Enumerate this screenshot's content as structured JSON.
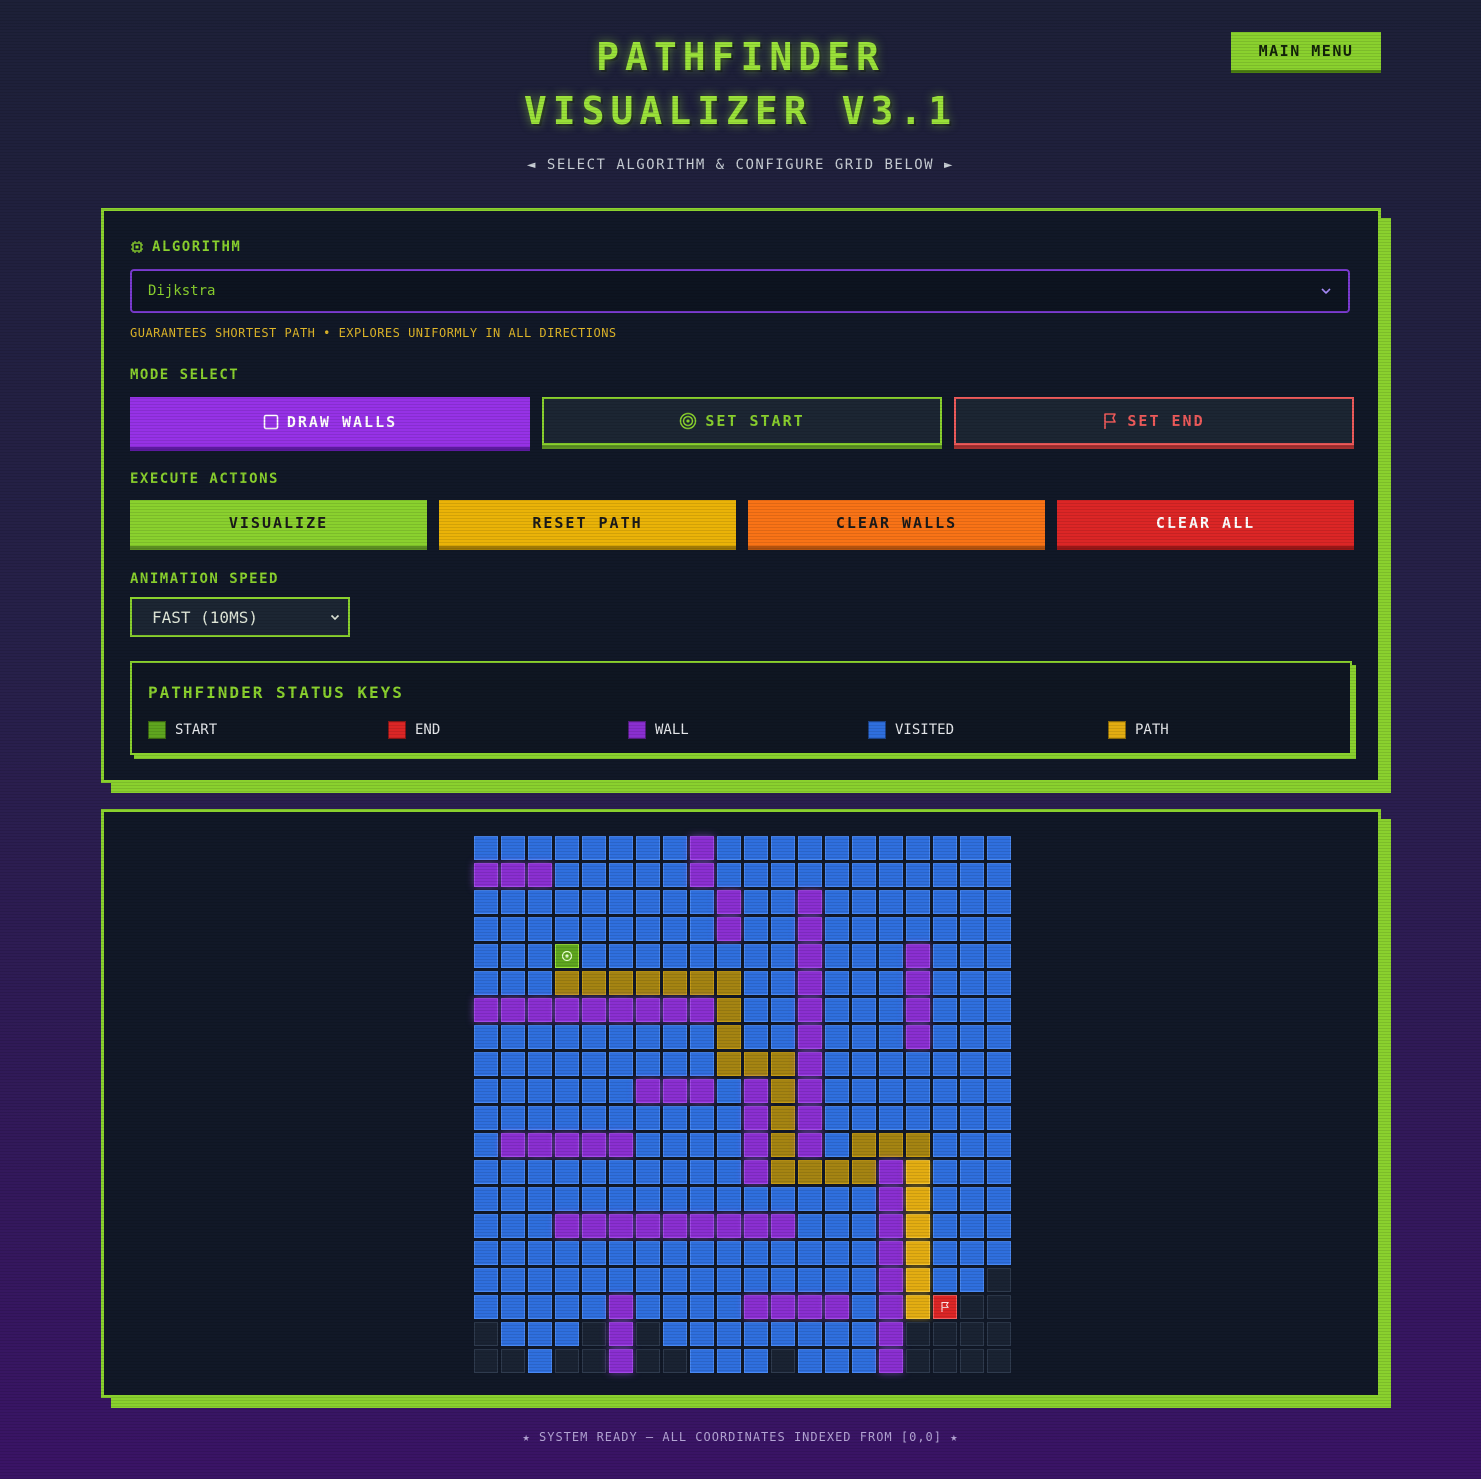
{
  "header": {
    "title_line1": "PATHFINDER",
    "title_line2": "VISUALIZER V3.1",
    "subtitle": "◄ SELECT ALGORITHM & CONFIGURE GRID BELOW ►",
    "main_menu_label": "MAIN MENU"
  },
  "algorithm": {
    "label": "ALGORITHM",
    "selected": "Dijkstra",
    "description": "GUARANTEES SHORTEST PATH • EXPLORES UNIFORMLY IN ALL DIRECTIONS"
  },
  "mode": {
    "label": "MODE SELECT",
    "draw_walls": "DRAW WALLS",
    "set_start": "SET START",
    "set_end": "SET END",
    "active": "draw_walls"
  },
  "actions": {
    "label": "EXECUTE ACTIONS",
    "visualize": "VISUALIZE",
    "reset_path": "RESET PATH",
    "clear_walls": "CLEAR WALLS",
    "clear_all": "CLEAR ALL"
  },
  "speed": {
    "label": "ANIMATION SPEED",
    "selected": "FAST (10MS)"
  },
  "legend": {
    "title": "PATHFINDER STATUS KEYS",
    "items": [
      {
        "label": "START",
        "color": "#5fa61f"
      },
      {
        "label": "END",
        "color": "#dc2626"
      },
      {
        "label": "WALL",
        "color": "#8a2fd1"
      },
      {
        "label": "VISITED",
        "color": "#2f6fde"
      },
      {
        "label": "PATH",
        "color": "#e3ad12"
      }
    ]
  },
  "grid": {
    "cols": 20,
    "rows": 20,
    "key": {
      "V": "visited",
      "W": "wall",
      "P": "path",
      "B": "path",
      "E": "empty",
      "S": "start",
      "X": "end"
    },
    "cells": [
      "VVVVVVVVWVVVVVVVVVVV",
      "WWWVVVVVWVVVVVVVVVVV",
      "VVVVVVVVVWVVWVVVVVVV",
      "VVVVVVVVVWVVWVVVVVVV",
      "VVVSVVVVVVVVWVVVWVVV",
      "VVVPPPPPPPVVWVVVWVVV",
      "WWWWWWWWWPVVWVVVWVVV",
      "VVVVVVVVVPVVWVVVWVVV",
      "VVVVVVVVVPPPWVVVVVVV",
      "VVVVVVWWWVWPWVVVVVVV",
      "VVVVVVVVVVWPWVVVVVVV",
      "VWWWWWVVVVWPWVPPPVVV",
      "VVVVVVVVVVWPPPPWBVVV",
      "VVVVVVVVVVVVVVVWBVVV",
      "VVVWWWWWWWWWVVVWBVVV",
      "VVVVVVVVVVVVVVVWBVVV",
      "VVVVVVVVVVVVVVVWBVVE",
      "VVVVVWVVVVWWWWVWBXEE",
      "EVVVEWEVVVVVVVVWEEEE",
      "EEVEEWEEVVVEVVVWEEEE"
    ]
  },
  "footer": "★ SYSTEM READY — ALL COORDINATES INDEXED FROM [0,0] ★"
}
